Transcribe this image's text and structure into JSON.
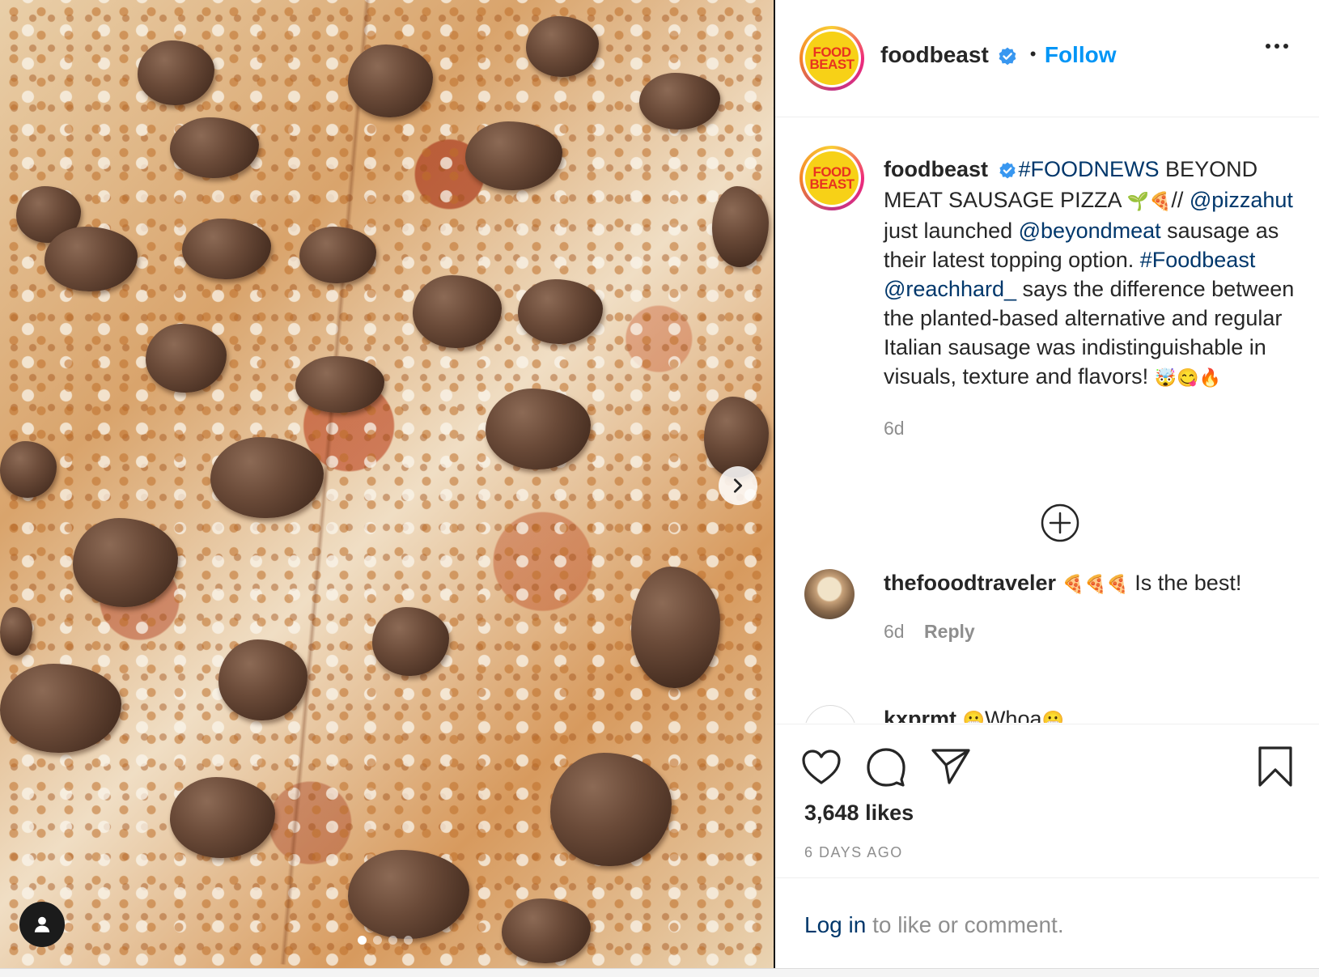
{
  "post": {
    "username": "foodbeast",
    "follow_label": "Follow",
    "separator": "•",
    "avatar_logo": {
      "line1": "FOOD",
      "line2": "BEAST"
    },
    "accent": "#0095f6"
  },
  "caption": {
    "username": "foodbeast",
    "hashtag_news": "#FOODNEWS",
    "text_1": " BEYOND MEAT SAUSAGE PIZZA ",
    "emoji_1": "🌱🍕",
    "text_2": "// ",
    "mention_pizzahut": "@pizzahut",
    "text_3": " just launched ",
    "mention_beyondmeat": "@beyondmeat",
    "text_4": " sausage as their latest topping option. ",
    "hashtag_foodbeast": "#Foodbeast",
    "text_5": " ",
    "mention_reachhard": "@reachhard_",
    "text_6": " says the difference between the planted-based alternative and regular Italian sausage was indistinguishable in visuals, texture and flavors! ",
    "emoji_2": "🤯😋🔥",
    "time": "6d"
  },
  "comments": [
    {
      "username": "thefooodtraveler",
      "emoji": "🍕🍕🍕",
      "text": " Is the best!",
      "time": "6d",
      "reply_label": "Reply"
    },
    {
      "username": "kxprmt",
      "emoji_a": "😬",
      "text": "Whoa",
      "emoji_b": "😬"
    }
  ],
  "actions": {
    "likes": "3,648 likes",
    "age": "6 DAYS AGO",
    "icons": [
      "heart-icon",
      "comment-icon",
      "share-icon",
      "save-icon"
    ]
  },
  "login": {
    "link": "Log in",
    "rest": " to like or comment."
  },
  "media": {
    "slide_current": 1,
    "slide_count": 4
  }
}
